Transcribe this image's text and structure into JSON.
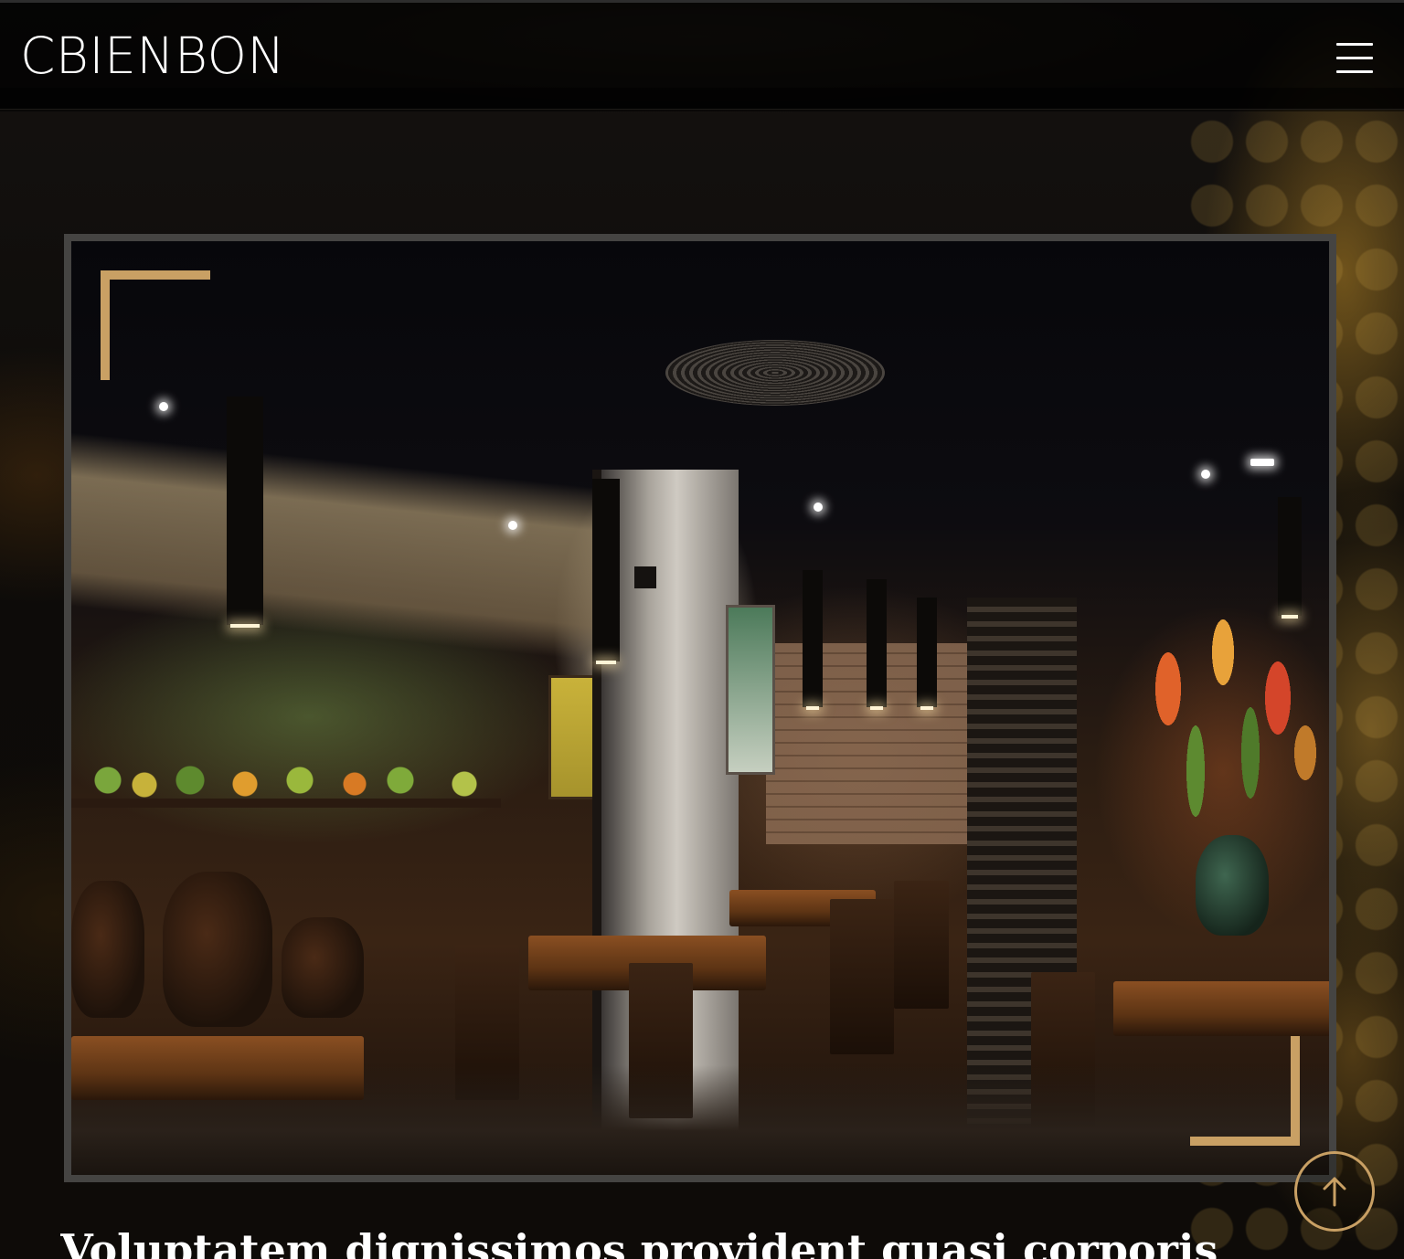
{
  "header": {
    "logo": "CBIENBON",
    "menu_icon": "hamburger-menu-icon"
  },
  "hero": {
    "image_description_icon": "restaurant-interior-photo"
  },
  "article": {
    "headline": "Voluptatem dignissimos provident quasi corporis"
  },
  "back_to_top": {
    "icon": "arrow-up-icon"
  },
  "colors": {
    "accent": "#c9a064",
    "header_bg": "#000000",
    "text": "#ffffff",
    "frame_border": "#454442"
  }
}
